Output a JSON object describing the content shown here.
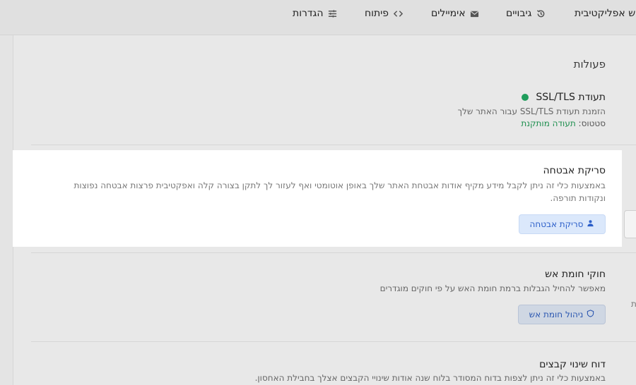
{
  "nav": {
    "items": [
      {
        "label": "הגדרות",
        "icon": "sliders-icon"
      },
      {
        "label": "פיתוח",
        "icon": "code-icon"
      },
      {
        "label": "אימיילים",
        "icon": "mail-icon"
      },
      {
        "label": "גיבויים",
        "icon": "history-icon"
      },
      {
        "label": "הש אפליקטיבית",
        "icon": ""
      }
    ]
  },
  "actions": {
    "title": "פעולות",
    "ssl": {
      "title": "תעודת SSL/TLS",
      "desc": "הזמנת תעודת SSL/TLS עבור האתר שלך",
      "status_label": "סטטוס:",
      "status_value": "תעודה מותקנת",
      "status_color": "#1f9d5c"
    },
    "scan": {
      "title": "סריקת אבטחה",
      "desc": "באמצעות כלי זה ניתן לקבל מידע מקיף אודות אבטחת האתר שלך באופן אוטומטי ואף לעזור לך לתקן בצורה קלה ואפקטיבית פרצות אבטחה נפוצות ונקודות תורפה.",
      "button": "סריקת אבטחה"
    },
    "firewall": {
      "title": "חוקי חומת אש",
      "desc": "מאפשר להחיל הגבלות ברמת חומת האש על פי חוקים מוגדרים",
      "button": "ניהול חומת אש"
    },
    "filechanges": {
      "title": "דוח שינוי קבצים",
      "desc": "באמצעות כלי זה ניתן לצפות בדוח המסודר בלוח שנה אודות שינויי הקבצים אצלך בחבילת האחסון."
    }
  },
  "side": {
    "edge_char": "ת"
  }
}
